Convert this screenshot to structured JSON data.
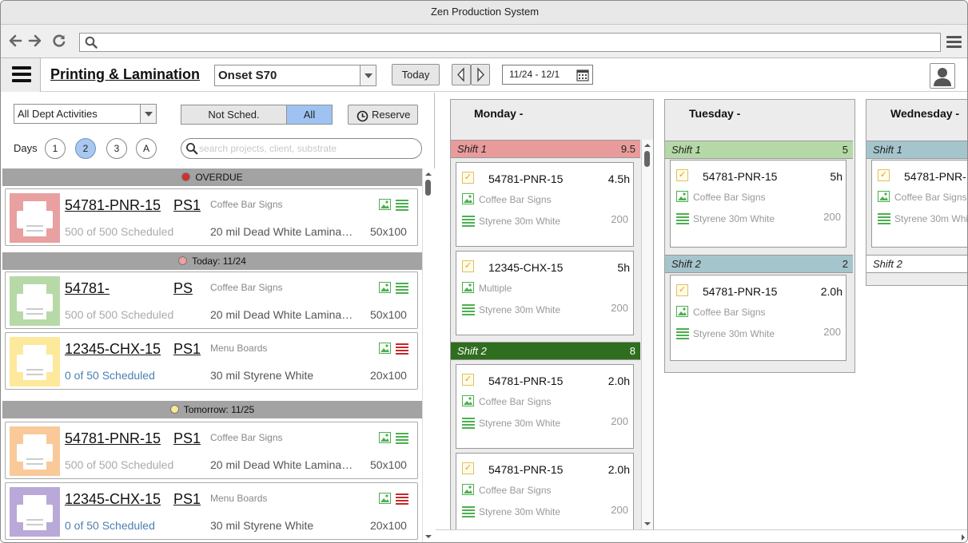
{
  "window": {
    "title": "Zen Production System"
  },
  "browser": {
    "url": ""
  },
  "header": {
    "title": "Printing & Lamination",
    "machine": "Onset S70",
    "today_label": "Today",
    "date_range": "11/24 - 12/1"
  },
  "filters": {
    "activity": "All Dept Activities",
    "toggle": [
      "Not Sched.",
      "All"
    ],
    "reserve_label": "Reserve",
    "days_label": "Days",
    "days_options": [
      "1",
      "2",
      "3",
      "A"
    ],
    "days_selected": "2",
    "search_placeholder": "search projects, client, substrate"
  },
  "groups": [
    {
      "label": "OVERDUE",
      "dot_color": "#d32f2f",
      "items": [
        {
          "job": "54781-PNR-15",
          "press": "PS1",
          "client": "Coffee Bar Signs",
          "scheduled": "500 of 500 Scheduled",
          "material": "20 mil Dead White Laminate...",
          "size": "50x100",
          "thumb_color": "#e8a0a0",
          "lines_color": "#4caf50",
          "sched_style": "grey"
        }
      ]
    },
    {
      "label": "Today: 11/24",
      "dot_color": "#f2a0a0",
      "items": [
        {
          "job": "54781-",
          "press": "PS",
          "client": "Coffee Bar Signs",
          "scheduled": "500 of 500 Scheduled",
          "material": "20 mil Dead White Laminate...",
          "size": "50x100",
          "thumb_color": "#b7d9a8",
          "lines_color": "#4caf50",
          "sched_style": "grey"
        },
        {
          "job": "12345-CHX-15",
          "press": "PS1",
          "client": "Menu Boards",
          "scheduled": "0 of 50 Scheduled",
          "material": "30 mil Styrene White",
          "size": "20x100",
          "thumb_color": "#fce99b",
          "lines_color": "#c62828",
          "sched_style": "blue"
        }
      ]
    },
    {
      "label": "Tomorrow: 11/25",
      "dot_color": "#fbe69a",
      "items": [
        {
          "job": "54781-PNR-15",
          "press": "PS1",
          "client": "Coffee Bar Signs",
          "scheduled": "500 of 500 Scheduled",
          "material": "20 mil Dead White Laminate...",
          "size": "50x100",
          "thumb_color": "#f9c99a",
          "lines_color": "#4caf50",
          "sched_style": "grey"
        },
        {
          "job": "12345-CHX-15",
          "press": "PS1",
          "client": "Menu Boards",
          "scheduled": "0 of 50 Scheduled",
          "material": "30 mil Styrene White",
          "size": "20x100",
          "thumb_color": "#b9a9d8",
          "lines_color": "#c62828",
          "sched_style": "blue"
        }
      ]
    }
  ],
  "days": [
    {
      "name": "Monday -",
      "shifts": [
        {
          "label": "Shift 1",
          "count": "9.5",
          "color": "#e99b9b",
          "tasks": [
            {
              "job": "54781-PNR-15",
              "hours": "4.5h",
              "client": "Coffee Bar Signs",
              "material": "Styrene 30m White",
              "qty": "200"
            },
            {
              "job": "12345-CHX-15",
              "hours": "5h",
              "client": "Multiple",
              "material": "Styrene 30m White",
              "qty": "200"
            }
          ]
        },
        {
          "label": "Shift 2",
          "count": "8",
          "color": "#2e6e1e",
          "tasks": [
            {
              "job": "54781-PNR-15",
              "hours": "2.0h",
              "client": "Coffee Bar Signs",
              "material": "Styrene 30m White",
              "qty": "200"
            },
            {
              "job": "54781-PNR-15",
              "hours": "2.0h",
              "client": "Coffee Bar Signs",
              "material": "Styrene 30m White",
              "qty": "200"
            }
          ]
        }
      ]
    },
    {
      "name": "Tuesday -",
      "shifts": [
        {
          "label": "Shift 1",
          "count": "5",
          "color": "#b5d9a6",
          "tasks": [
            {
              "job": "54781-PNR-15",
              "hours": "5h",
              "client": "Coffee Bar Signs",
              "material": "Styrene 30m White",
              "qty": "200"
            }
          ]
        },
        {
          "label": "Shift 2",
          "count": "2",
          "color": "#a5c5cc",
          "tasks": [
            {
              "job": "54781-PNR-15",
              "hours": "2.0h",
              "client": "Coffee Bar Signs",
              "material": "Styrene 30m White",
              "qty": "200"
            }
          ]
        }
      ]
    },
    {
      "name": "Wednesday -",
      "shifts": [
        {
          "label": "Shift 1",
          "count": "",
          "color": "#a5c5cc",
          "tasks": [
            {
              "job": "54781-PNR-",
              "hours": "",
              "client": "Coffee Bar Signs",
              "material": "Styrene 30m Whi",
              "qty": ""
            }
          ]
        },
        {
          "label": "Shift 2",
          "count": "",
          "color": "#ffffff",
          "tasks": []
        }
      ]
    }
  ]
}
